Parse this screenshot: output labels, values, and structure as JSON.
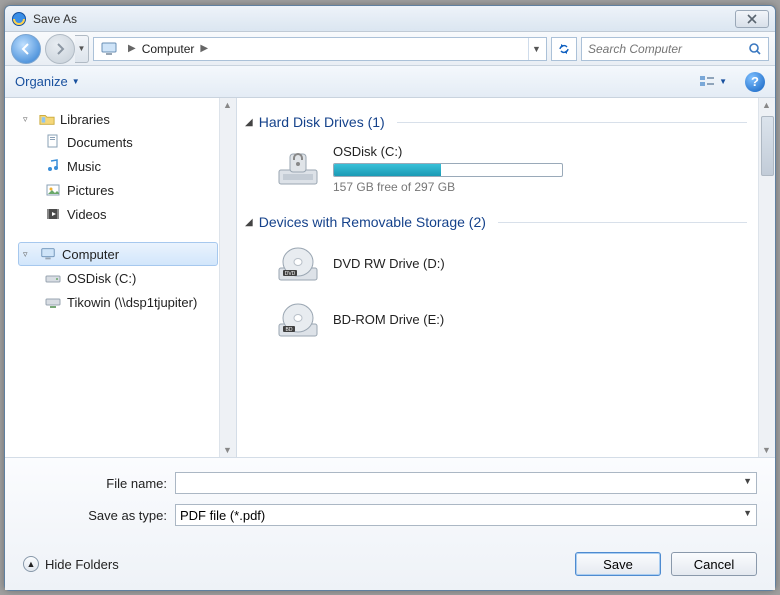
{
  "titlebar": {
    "title": "Save As"
  },
  "nav": {
    "location": "Computer",
    "search_placeholder": "Search Computer"
  },
  "toolbar": {
    "organize": "Organize"
  },
  "sidebar": {
    "libraries": {
      "label": "Libraries",
      "items": [
        {
          "label": "Documents",
          "icon": "documents"
        },
        {
          "label": "Music",
          "icon": "music"
        },
        {
          "label": "Pictures",
          "icon": "pictures"
        },
        {
          "label": "Videos",
          "icon": "videos"
        }
      ]
    },
    "computer": {
      "label": "Computer",
      "items": [
        {
          "label": "OSDisk (C:)",
          "icon": "drive"
        },
        {
          "label": "Tikowin (\\\\dsp1tjupiter)",
          "icon": "netdrive"
        }
      ]
    }
  },
  "main": {
    "section1": {
      "title": "Hard Disk Drives (1)"
    },
    "osdisk": {
      "name": "OSDisk (C:)",
      "free_text": "157 GB free of 297 GB",
      "used_pct": 47
    },
    "section2": {
      "title": "Devices with Removable Storage (2)"
    },
    "dvd": {
      "name": "DVD RW Drive (D:)"
    },
    "bd": {
      "name": "BD-ROM Drive (E:)"
    }
  },
  "footer": {
    "filename_label": "File name:",
    "filename_value": "",
    "type_label": "Save as type:",
    "type_value": "PDF file (*.pdf)",
    "hide_folders": "Hide Folders",
    "save": "Save",
    "cancel": "Cancel"
  }
}
